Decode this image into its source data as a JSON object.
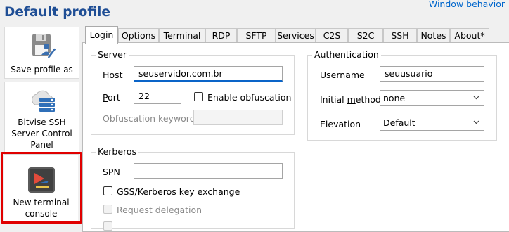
{
  "header": {
    "title": "Default profile",
    "window_behavior_link": "Window behavior"
  },
  "sidebar": {
    "items": [
      {
        "label": "Save profile as",
        "icon": "save-profile-icon"
      },
      {
        "label_lines": [
          "Bitvise SSH",
          "Server Control",
          "Panel"
        ],
        "icon": "server-control-panel-icon"
      },
      {
        "label_lines": [
          "New terminal",
          "console"
        ],
        "icon": "terminal-console-icon",
        "highlighted": true
      }
    ]
  },
  "tabs": [
    {
      "label": "Login",
      "active": true
    },
    {
      "label": "Options"
    },
    {
      "label": "Terminal"
    },
    {
      "label": "RDP"
    },
    {
      "label": "SFTP"
    },
    {
      "label": "Services"
    },
    {
      "label": "C2S"
    },
    {
      "label": "S2C"
    },
    {
      "label": "SSH"
    },
    {
      "label": "Notes"
    },
    {
      "label": "About*"
    }
  ],
  "server": {
    "legend": "Server",
    "host_label_pre": "H",
    "host_label_post": "ost",
    "host_value": "seuservidor.com.br",
    "port_label_pre": "P",
    "port_label_post": "ort",
    "port_value": "22",
    "obfuscation_checkbox": {
      "label": "Enable obfuscation",
      "checked": false
    },
    "obfuscation_keyword_label": "Obfuscation keyword",
    "obfuscation_keyword_value": ""
  },
  "kerberos": {
    "legend": "Kerberos",
    "spn_label": "SPN",
    "spn_value": "",
    "gss_checkbox": {
      "label": "GSS/Kerberos key exchange",
      "checked": false
    },
    "delegation_checkbox": {
      "label": "Request delegation",
      "checked": false,
      "disabled": true
    }
  },
  "authentication": {
    "legend": "Authentication",
    "username_label_pre": "U",
    "username_label_post": "sername",
    "username_value": "seuusuario",
    "initial_method_label_pre": "Initial ",
    "initial_method_label_acc": "m",
    "initial_method_label_post": "ethod",
    "initial_method_value": "none",
    "elevation_label": "Elevation",
    "elevation_value": "Default"
  },
  "colors": {
    "title": "#1f4e95",
    "link": "#0066cc",
    "highlight_border": "#e00000",
    "focus_underline": "#0a64c8"
  }
}
